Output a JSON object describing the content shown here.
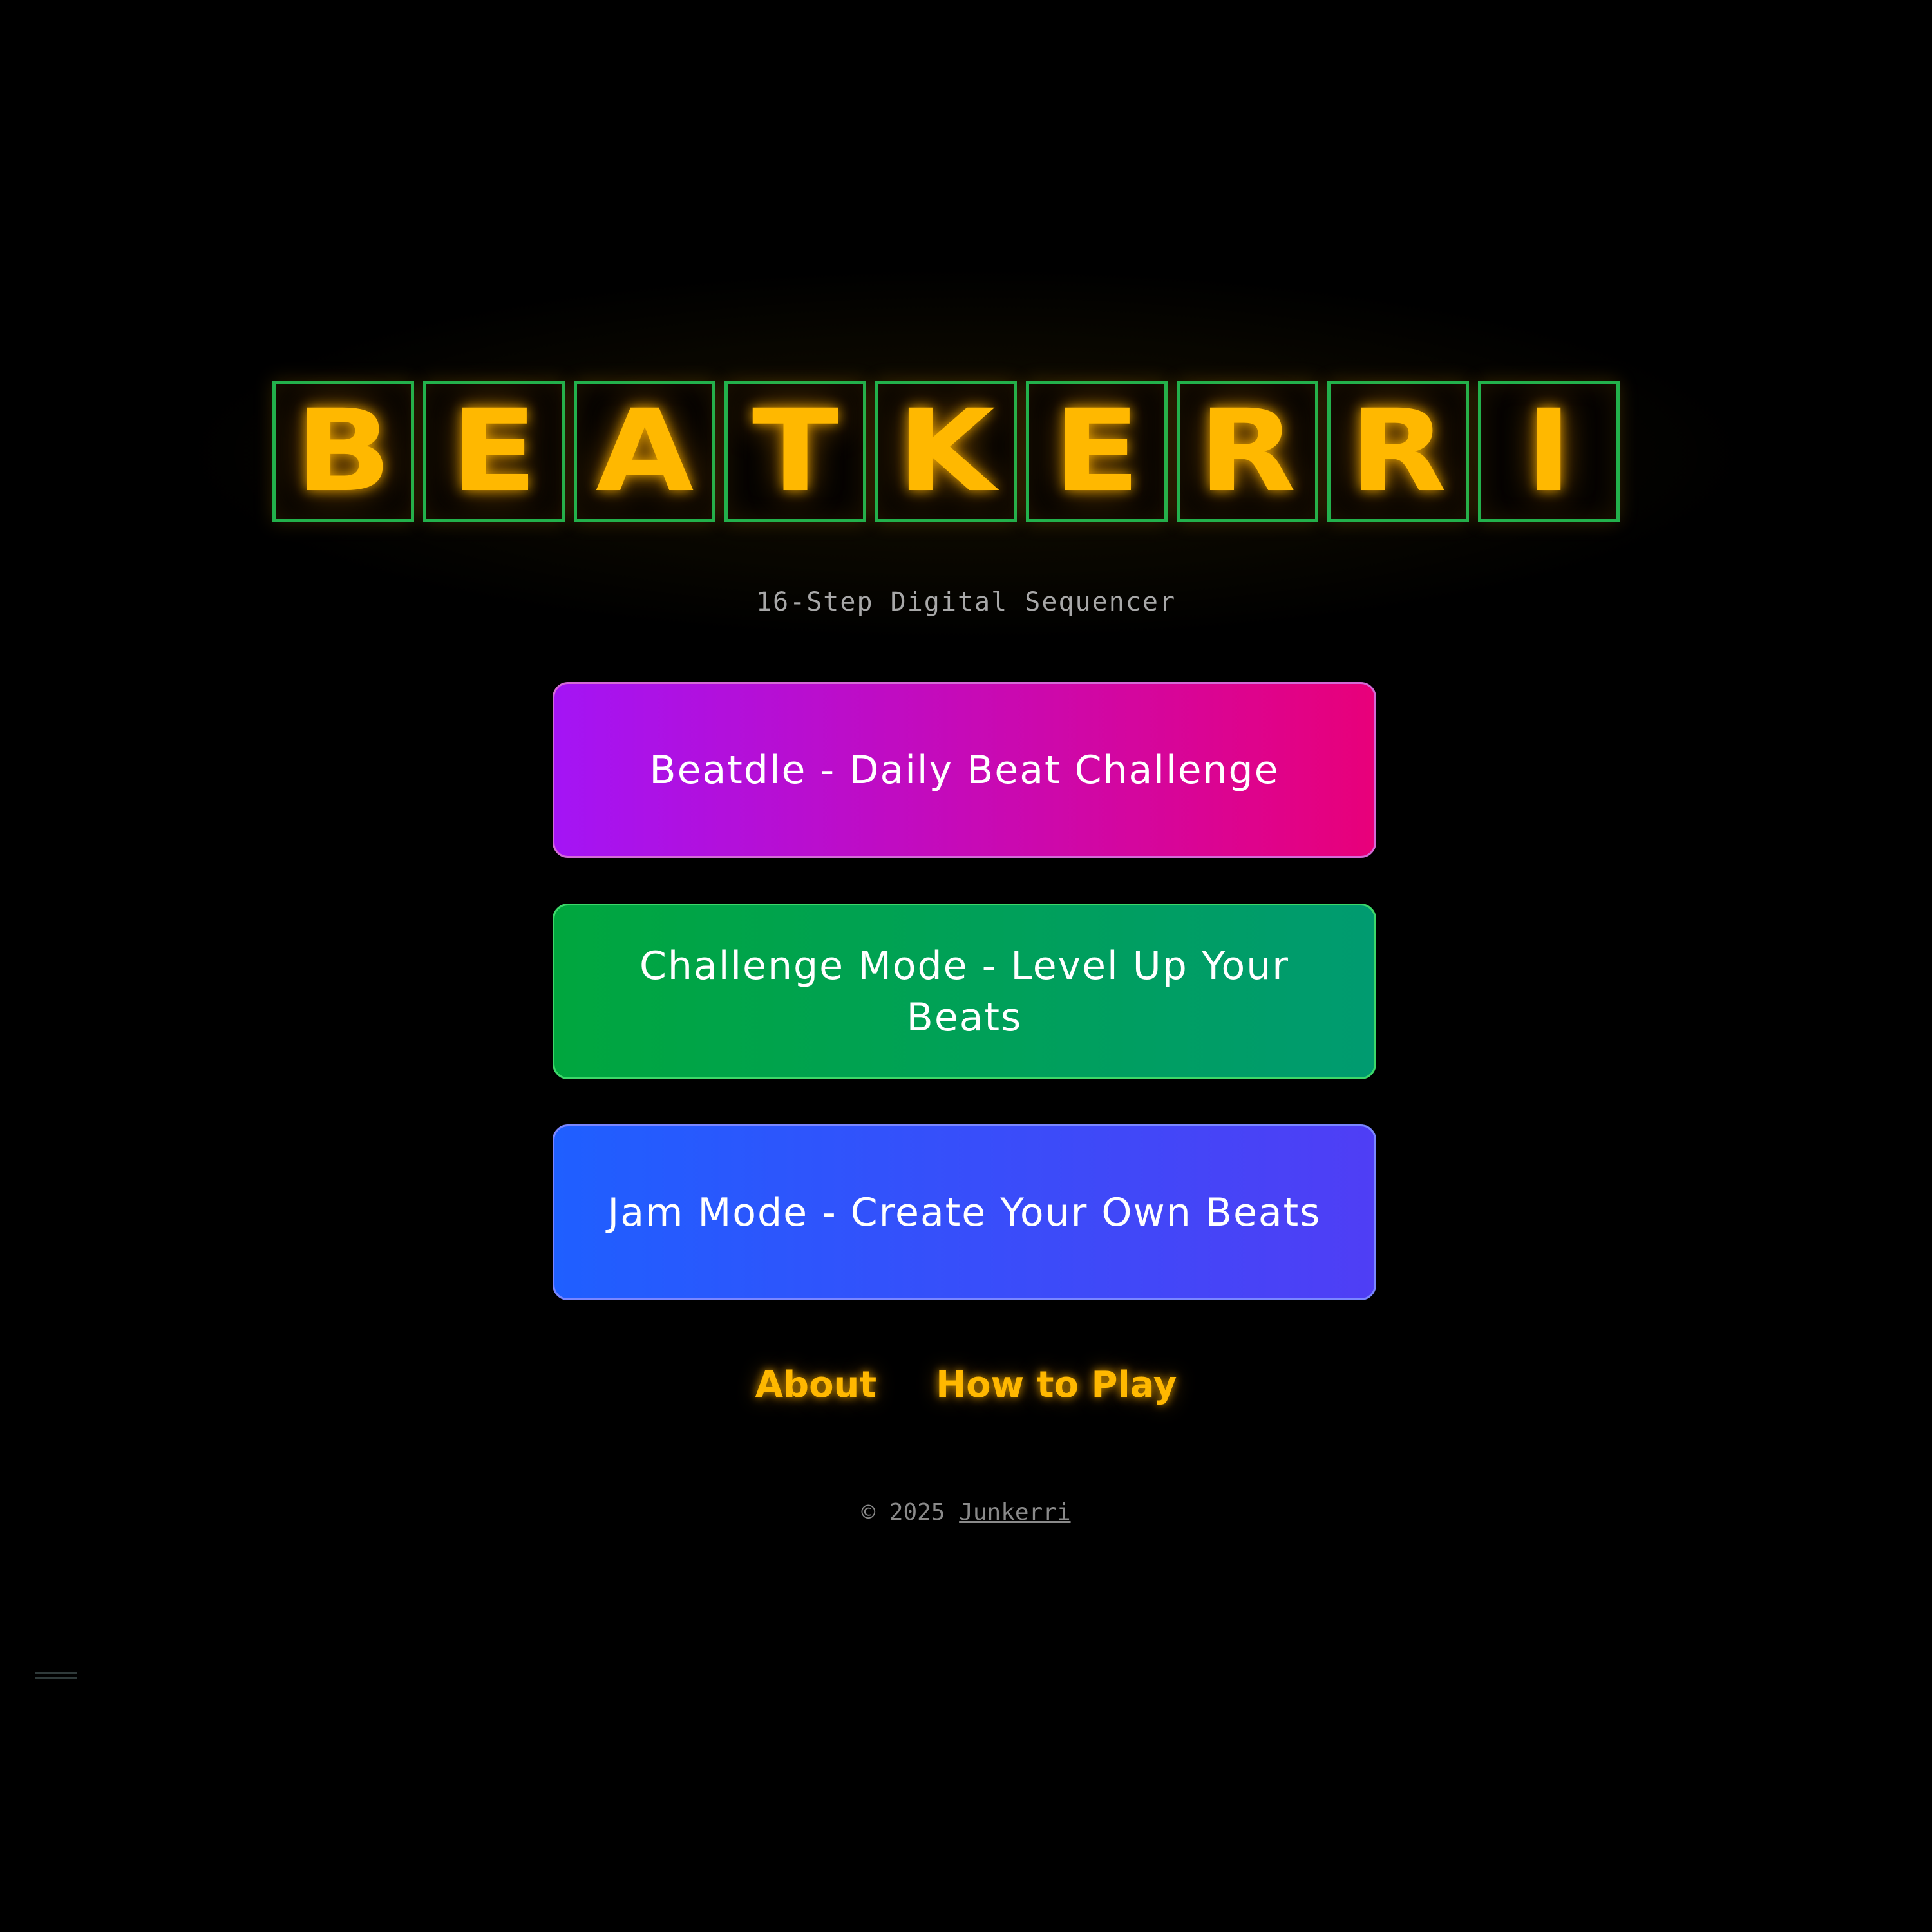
{
  "logo": {
    "letters": [
      "B",
      "E",
      "A",
      "T",
      "K",
      "E",
      "R",
      "R",
      "I"
    ]
  },
  "subtitle": "16-Step Digital Sequencer",
  "modes": [
    {
      "label": "Beatdle - Daily Beat Challenge",
      "gradient_start": "#a414f5",
      "gradient_end": "#e8007a"
    },
    {
      "label": "Challenge Mode - Level Up Your Beats",
      "gradient_start": "#00a63e",
      "gradient_end": "#009b70"
    },
    {
      "label": "Jam Mode - Create Your Own Beats",
      "gradient_start": "#1f5fff",
      "gradient_end": "#4f3ef5"
    }
  ],
  "nav": {
    "about": "About",
    "how_to_play": "How to Play"
  },
  "footer": {
    "copyright": "© 2025",
    "author": "Junkerri"
  },
  "colors": {
    "background": "#000000",
    "logo_letter": "#ffb800",
    "logo_border": "#22b14c",
    "nav_link": "#ffb800",
    "subtitle": "#a8a8a8",
    "footer": "#8a8a8a"
  },
  "icons": {
    "corner": "menu-lines-icon"
  }
}
